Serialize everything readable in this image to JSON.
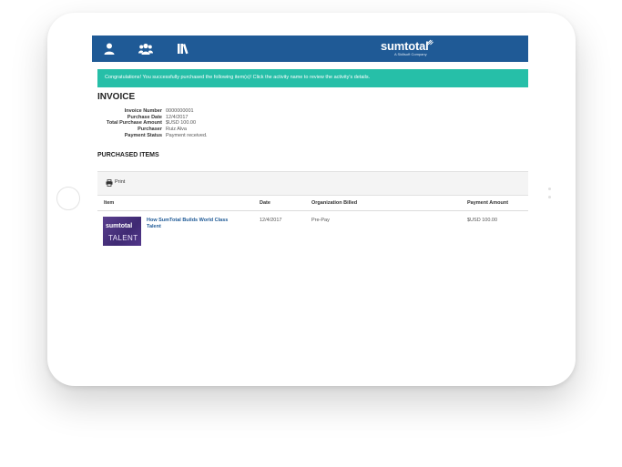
{
  "header": {
    "brand": "sumtotal",
    "brand_subtitle": "A Skillsoft Company",
    "icons": [
      "user-icon",
      "users-icon",
      "library-icon"
    ],
    "background": "#1f5a96"
  },
  "banner": {
    "message": "Congratulations! You successfully purchased the following item(s)! Click the activity name to review the activity's details.",
    "color": "#26bfa8"
  },
  "invoice": {
    "title": "INVOICE",
    "fields": [
      {
        "label": "Invoice Number",
        "value": "0000000001"
      },
      {
        "label": "Purchase Date",
        "value": "12/4/2017"
      },
      {
        "label": "Total Purchase Amount",
        "value": "$USD 100.00"
      },
      {
        "label": "Purchaser",
        "value": "Ruiz Alva"
      },
      {
        "label": "Payment Status",
        "value": "Payment received."
      }
    ]
  },
  "purchased": {
    "title": "PURCHASED ITEMS",
    "print_label": "Print",
    "columns": [
      "Item",
      "Date",
      "Organization Billed",
      "Payment Amount"
    ],
    "rows": [
      {
        "thumbnail_brand": "sumtotal",
        "thumbnail_word": "TALENT",
        "item": "How SumTotal Builds World Class Talent",
        "date": "12/4/2017",
        "organization": "Pre-Pay",
        "amount": "$USD 100.00"
      }
    ]
  }
}
